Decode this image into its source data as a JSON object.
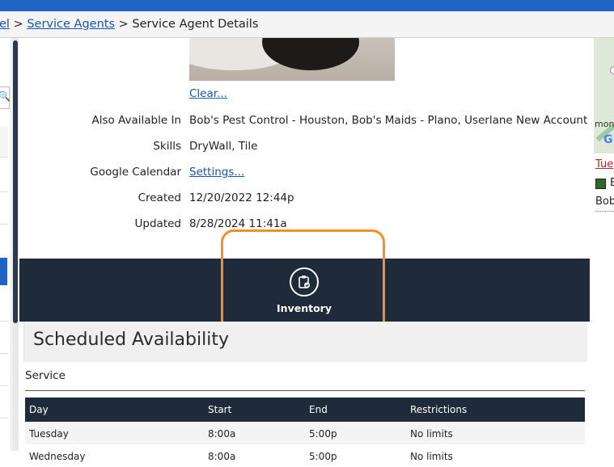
{
  "breadcrumb": {
    "first_partial": "el",
    "second": "Service Agents",
    "current": "Service Agent Details",
    "separator": ">"
  },
  "photo": {
    "clear_label": "Clear..."
  },
  "details": [
    {
      "label": "Also Available In",
      "value": "Bob's Pest Control - Houston, Bob's Maids - Plano, Userlane New Account",
      "is_link": false
    },
    {
      "label": "Skills",
      "value": "DryWall, Tile",
      "is_link": false
    },
    {
      "label": "Google Calendar",
      "value": "Settings...",
      "is_link": true
    },
    {
      "label": "Created",
      "value": "12/20/2022 12:44p",
      "is_link": false
    },
    {
      "label": "Updated",
      "value": "8/28/2024 11:41a",
      "is_link": false
    }
  ],
  "toolbar": {
    "inventory_label": "Inventory",
    "inventory_icon": "clipboard-check-icon"
  },
  "schedule": {
    "title": "Scheduled Availability",
    "service_label": "Service",
    "columns": [
      "Day",
      "Start",
      "End",
      "Restrictions"
    ],
    "rows": [
      [
        "Tuesday",
        "8:00a",
        "5:00p",
        "No limits"
      ],
      [
        "Wednesday",
        "8:00a",
        "5:00p",
        "No limits"
      ]
    ]
  },
  "right_panel": {
    "map_text": "mon",
    "map_logo": "G",
    "day_link": "Tue",
    "legend_text": "B",
    "agent_name": "Bob"
  },
  "colors": {
    "top_bar": "#1f63c6",
    "dark_bar": "#1f2b3a",
    "highlight": "#f39025",
    "link": "#1a55a8",
    "legend_swatch": "#2e6b2a"
  }
}
